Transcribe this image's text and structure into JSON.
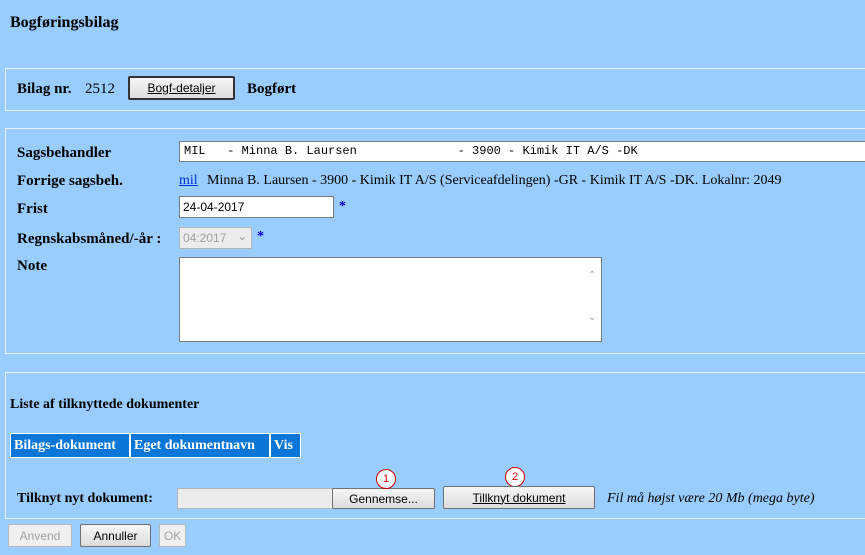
{
  "page": {
    "title": "Bogføringsbilag"
  },
  "bilag": {
    "label": "Bilag nr.",
    "number": "2512",
    "details_button": "Bogf-detaljer",
    "status": "Bogført"
  },
  "form": {
    "sagsbehandler_label": "Sagsbehandler",
    "sagsbehandler_value": "MIL   - Minna B. Laursen              - 3900 - Kimik IT A/S -DK",
    "forrige_label": "Forrige sagsbeh.",
    "forrige_link": "mil",
    "forrige_text": "Minna B. Laursen - 3900 - Kimik IT A/S (Serviceafdelingen) -GR - Kimik IT A/S -DK. Lokalnr: 2049",
    "frist_label": "Frist",
    "frist_value": "24-04-2017",
    "regnskab_label": "Regnskabsmåned/-år :",
    "regnskab_value": "04:2017",
    "note_label": "Note",
    "note_value": "",
    "required_mark": "*"
  },
  "documents": {
    "heading": "Liste af tilknyttede dokumenter",
    "columns": [
      "Bilags-dokument",
      "Eget dokumentnavn",
      "Vis"
    ],
    "attach_label": "Tilknyt nyt dokument:",
    "file_value": "",
    "browse_button": "Gennemse...",
    "attach_button": "Tillknyt dokument",
    "size_note": "Fil må højst være 20 Mb (mega byte)",
    "markers": [
      "1",
      "2"
    ]
  },
  "footer": {
    "anvend": "Anvend",
    "annuller": "Annuller",
    "ok": "OK"
  }
}
